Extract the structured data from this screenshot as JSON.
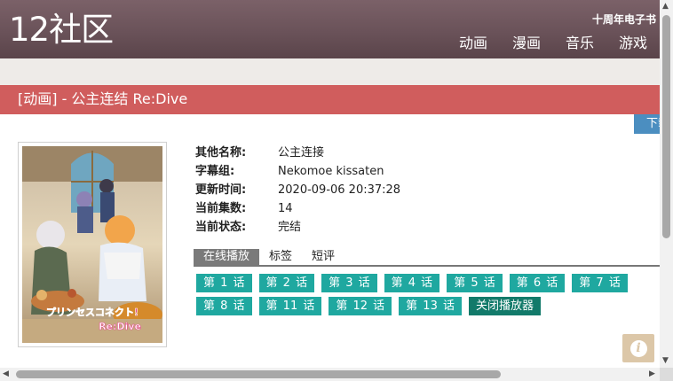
{
  "header": {
    "logo": "12社区",
    "ebook_link": "十周年电子书",
    "nav": [
      "动画",
      "漫画",
      "音乐",
      "游戏"
    ]
  },
  "page": {
    "title": "[动画] - 公主连结 Re:Dive",
    "download_label": "下载"
  },
  "poster": {
    "logo_text": "プリンセスコネクト!",
    "logo_sub": "Re:Dive"
  },
  "info": [
    {
      "label": "其他名称:",
      "value": "公主连接"
    },
    {
      "label": "字幕组:",
      "value": "Nekomoe kissaten"
    },
    {
      "label": "更新时间:",
      "value": "2020-09-06 20:37:28"
    },
    {
      "label": "当前集数:",
      "value": "14"
    },
    {
      "label": "当前状态:",
      "value": "完结"
    }
  ],
  "tabs": [
    "在线播放",
    "标签",
    "短评"
  ],
  "episodes": [
    "第 1 话",
    "第 2 话",
    "第 3 话",
    "第 4 话",
    "第 5 话",
    "第 6 话",
    "第 7 话",
    "第 8 话",
    "第 11 话",
    "第 12 话",
    "第 13 话"
  ],
  "close_player": "关闭播放器",
  "info_fab": "i",
  "colors": {
    "header": "#6a5259",
    "title_bar": "#d05d5d",
    "episode": "#1fa8a0",
    "close": "#127a6a",
    "download": "#4b8ec0"
  }
}
